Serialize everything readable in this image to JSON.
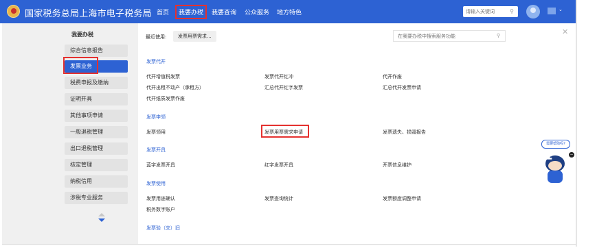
{
  "header": {
    "site_title": "国家税务总局上海市电子税务局",
    "nav": [
      {
        "label": "首页"
      },
      {
        "label": "我要办税",
        "active": true
      },
      {
        "label": "我要查询"
      },
      {
        "label": "公众服务"
      },
      {
        "label": "地方特色"
      }
    ],
    "search_placeholder": "请输入关键词",
    "search_icon": "search-icon",
    "avatar_icon": "user-avatar-icon",
    "brand_color": "#2d62d3",
    "highlight_color": "#e5312f"
  },
  "sidebar": {
    "title": "我要办税",
    "items": [
      {
        "label": "综合信息报告"
      },
      {
        "label": "发票业务",
        "active": true
      },
      {
        "label": "税费申报及缴纳"
      },
      {
        "label": "证明开具"
      },
      {
        "label": "其他事项申请"
      },
      {
        "label": "一般退税管理"
      },
      {
        "label": "出口退税管理"
      },
      {
        "label": "核定管理"
      },
      {
        "label": "纳税信用"
      },
      {
        "label": "涉税专业服务"
      }
    ]
  },
  "main": {
    "recent_label": "最近使用:",
    "recent_items": [
      "发票用票需求..."
    ],
    "search_placeholder": "在我要办税中搜索服务功能",
    "sections": [
      {
        "title": "发票代开",
        "links": [
          "代开增值税发票",
          "发票代开红冲",
          "代开作废",
          "代开出租不动产（承租方）",
          "汇总代开红字发票",
          "汇总代开发票申请",
          "代开纸质发票作废"
        ]
      },
      {
        "title": "发票申领",
        "links": [
          "发票领用",
          "发票用票需求申请",
          "发票遗失、损毁报告"
        ]
      },
      {
        "title": "发票开具",
        "links": [
          "蓝字发票开具",
          "红字发票开具",
          "开票信息维护"
        ]
      },
      {
        "title": "发票使用",
        "links": [
          "发票用途确认",
          "发票查询统计",
          "发票额度调整申请",
          "税务数字账户"
        ]
      },
      {
        "title": "发票验（交）旧",
        "links": []
      }
    ]
  },
  "assistant": {
    "bubble_text": "需要帮助吗?",
    "chars": [
      "征",
      "纳",
      "互",
      "动"
    ]
  }
}
